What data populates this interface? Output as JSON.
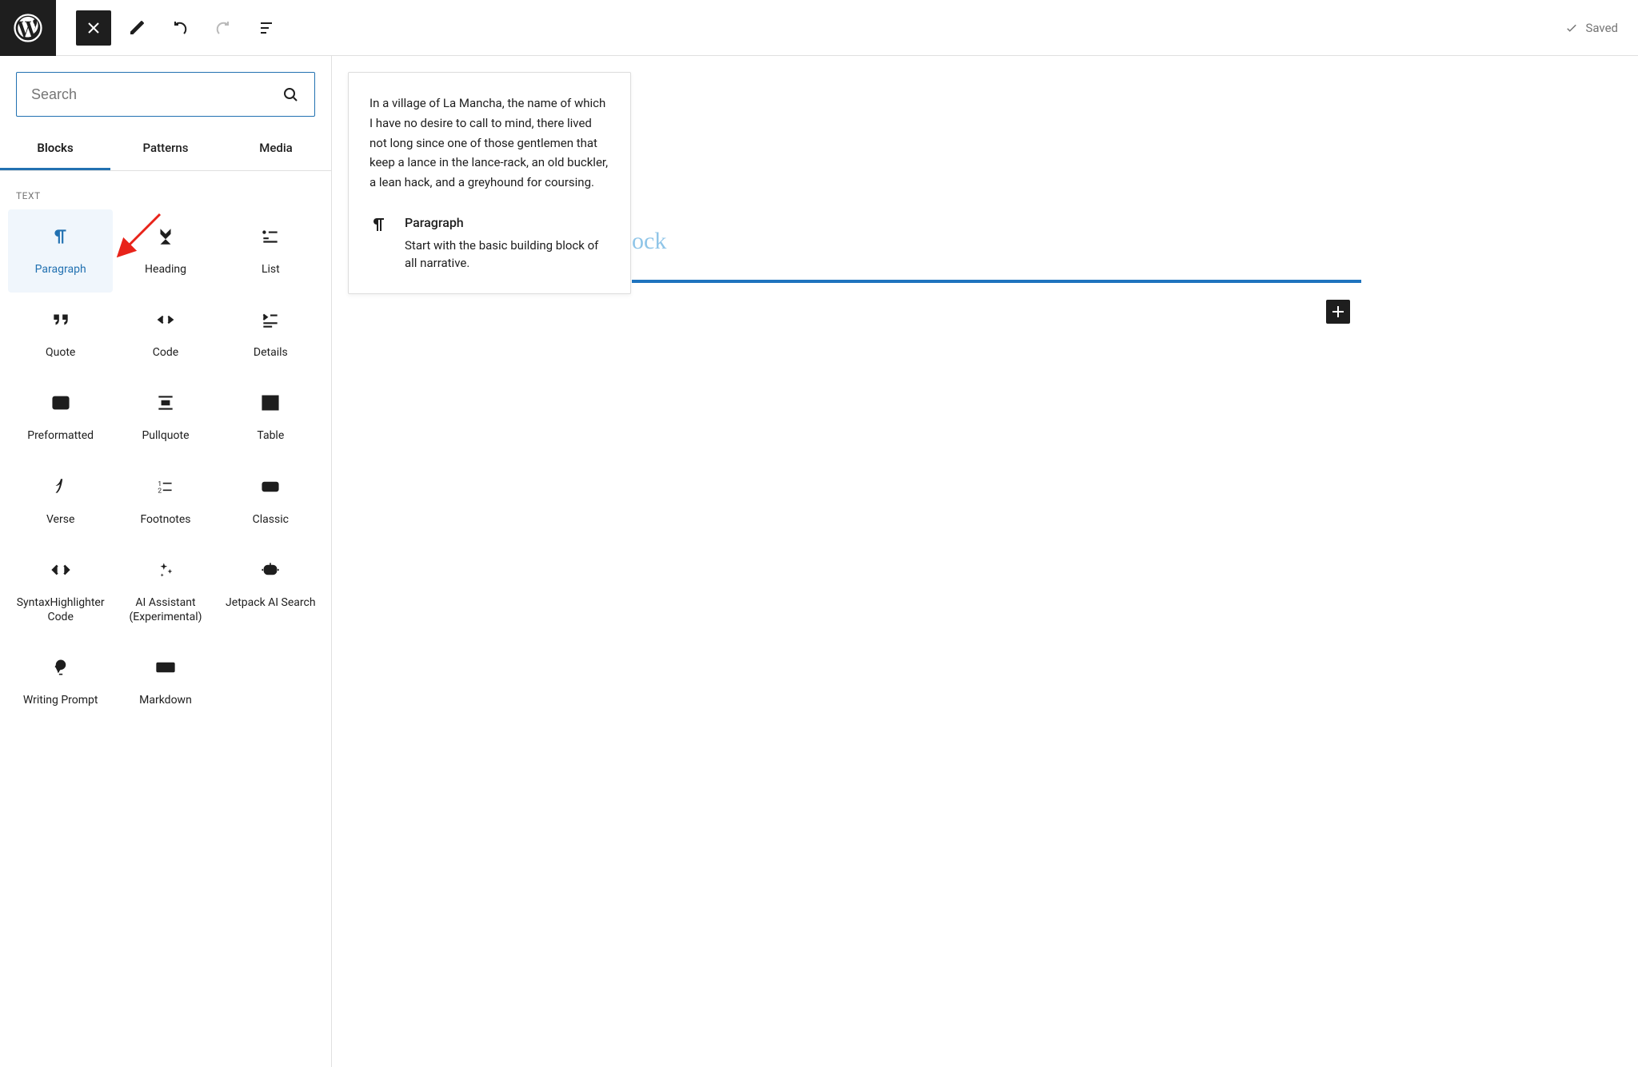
{
  "header": {
    "saved_label": "Saved"
  },
  "inserter": {
    "search_placeholder": "Search",
    "tabs": [
      "Blocks",
      "Patterns",
      "Media"
    ],
    "active_tab": 0,
    "category": "TEXT",
    "blocks": [
      {
        "id": "paragraph",
        "label": "Paragraph",
        "selected": true
      },
      {
        "id": "heading",
        "label": "Heading"
      },
      {
        "id": "list",
        "label": "List"
      },
      {
        "id": "quote",
        "label": "Quote"
      },
      {
        "id": "code",
        "label": "Code"
      },
      {
        "id": "details",
        "label": "Details"
      },
      {
        "id": "preformatted",
        "label": "Preformatted"
      },
      {
        "id": "pullquote",
        "label": "Pullquote"
      },
      {
        "id": "table",
        "label": "Table"
      },
      {
        "id": "verse",
        "label": "Verse"
      },
      {
        "id": "footnotes",
        "label": "Footnotes"
      },
      {
        "id": "classic",
        "label": "Classic"
      },
      {
        "id": "syntax",
        "label": "SyntaxHighlighter Code"
      },
      {
        "id": "ai",
        "label": "AI Assistant (Experimental)"
      },
      {
        "id": "jetpack",
        "label": "Jetpack AI Search"
      },
      {
        "id": "prompt",
        "label": "Writing Prompt"
      },
      {
        "id": "markdown",
        "label": "Markdown"
      }
    ]
  },
  "preview": {
    "sample_text": "In a village of La Mancha, the name of which I have no desire to call to mind, there lived not long since one of those gentlemen that keep a lance in the lance-rack, an old buckler, a lean hack, and a greyhound for coursing.",
    "title": "Paragraph",
    "description": "Start with the basic building block of all narrative."
  },
  "editor": {
    "placeholder_partial": "ock"
  }
}
